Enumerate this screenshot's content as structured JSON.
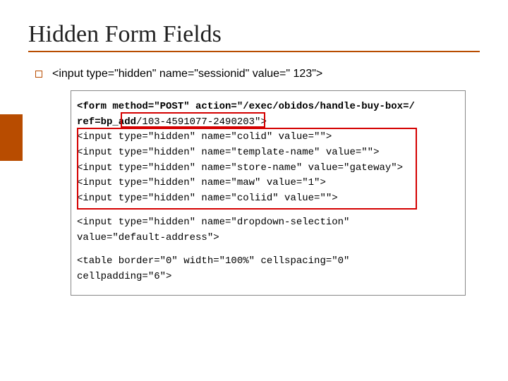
{
  "title": "Hidden Form Fields",
  "bullet": "<input type=\"hidden\" name=\"sessionid\" value=\" 123\">",
  "code": {
    "l1a": "<form method=\"POST\" action=\"/exec/obidos/handle-buy-box=/",
    "l1b": "ref=bp_add",
    "l1c": "/103-4591077-2490203\">",
    "l2": "<input type=\"hidden\" name=\"colid\" value=\"\">",
    "l3": "<input type=\"hidden\" name=\"template-name\" value=\"\">",
    "l4": "<input type=\"hidden\" name=\"store-name\" value=\"gateway\">",
    "l5": "<input type=\"hidden\" name=\"maw\" value=\"1\">",
    "l6": "<input type=\"hidden\" name=\"coliid\" value=\"\">",
    "l7": "<input type=\"hidden\" name=\"dropdown-selection\"",
    "l8": "value=\"default-address\">",
    "l9": "<table border=\"0\" width=\"100%\" cellspacing=\"0\"",
    "l10": "cellpadding=\"6\">"
  }
}
